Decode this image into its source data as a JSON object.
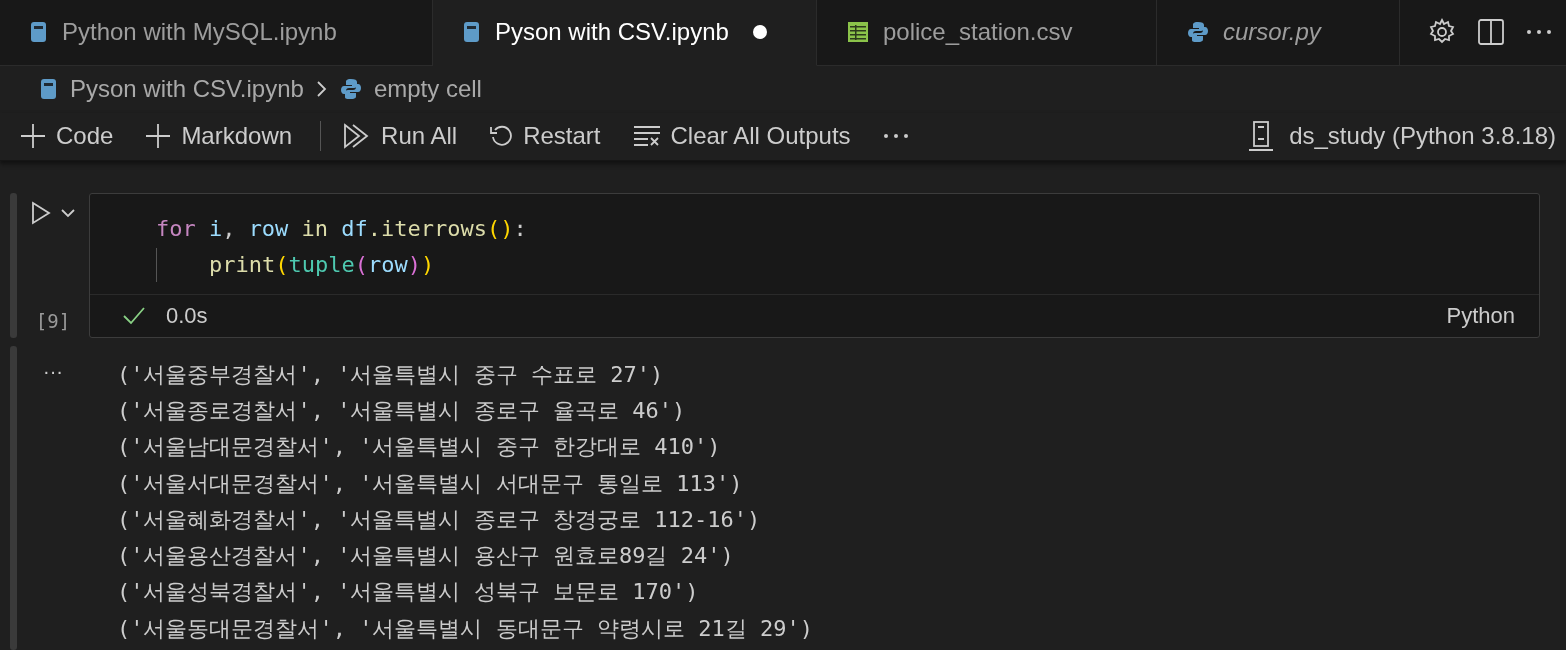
{
  "tabs": [
    {
      "label": "Python with MySQL.ipynb",
      "kind": "notebook",
      "selected": false,
      "modified": false,
      "italic": false
    },
    {
      "label": "Pyson with CSV.ipynb",
      "kind": "notebook",
      "selected": true,
      "modified": true,
      "italic": false
    },
    {
      "label": "police_station.csv",
      "kind": "csv",
      "selected": false,
      "modified": false,
      "italic": false
    },
    {
      "label": "cursor.py",
      "kind": "python",
      "selected": false,
      "modified": false,
      "italic": true
    }
  ],
  "breadcrumb": [
    {
      "label": "Pyson with CSV.ipynb",
      "kind": "notebook"
    },
    {
      "label": "empty cell",
      "kind": "python"
    }
  ],
  "toolbar": [
    {
      "label": "Code",
      "kind": "plus"
    },
    {
      "label": "Markdown",
      "kind": "plus"
    },
    {
      "kind": "separator"
    },
    {
      "label": "Run All",
      "kind": "run"
    },
    {
      "label": "Restart",
      "kind": "restart"
    },
    {
      "label": "Clear All Outputs",
      "kind": "clear"
    },
    {
      "kind": "more"
    }
  ],
  "kernel": "ds_study (Python 3.8.18)",
  "cell": {
    "execution_count": "[9]",
    "status": "0.0s",
    "success": true,
    "language": "Python",
    "lines": [
      {
        "indent": false,
        "tokens": [
          {
            "t": "for",
            "kind": "keyword",
            "gap": false
          },
          {
            "t": "i",
            "kind": "variable",
            "gap": true
          },
          {
            "t": ",",
            "kind": "plain",
            "gap": false
          },
          {
            "t": "row",
            "kind": "variable",
            "gap": true
          },
          {
            "t": "in",
            "kind": "function",
            "gap": true
          },
          {
            "t": "df",
            "kind": "variable",
            "gap": true
          },
          {
            "t": ".iterrows",
            "kind": "function",
            "gap": false
          },
          {
            "t": "()",
            "kind": "bracket1",
            "gap": false
          },
          {
            "t": ":",
            "kind": "plain",
            "gap": false
          }
        ]
      },
      {
        "indent": true,
        "tokens": [
          {
            "t": "print",
            "kind": "function",
            "gap": false
          },
          {
            "t": "(",
            "kind": "bracket1",
            "gap": false
          },
          {
            "t": "tuple",
            "kind": "builtin",
            "gap": false
          },
          {
            "t": "(",
            "kind": "bracket2",
            "gap": false
          },
          {
            "t": "row",
            "kind": "variable",
            "gap": false
          },
          {
            "t": ")",
            "kind": "bracket2",
            "gap": false
          },
          {
            "t": ")",
            "kind": "bracket1",
            "gap": false
          }
        ]
      }
    ]
  },
  "output": {
    "marker": "···",
    "lines": [
      "('서울중부경찰서', '서울특별시 중구 수표로 27')",
      "('서울종로경찰서', '서울특별시 종로구 율곡로 46')",
      "('서울남대문경찰서', '서울특별시 중구 한강대로 410')",
      "('서울서대문경찰서', '서울특별시 서대문구 통일로 113')",
      "('서울혜화경찰서', '서울특별시 종로구 창경궁로 112-16')",
      "('서울용산경찰서', '서울특별시 용산구 원효로89길 24')",
      "('서울성북경찰서', '서울특별시 성북구 보문로 170')",
      "('서울동대문경찰서', '서울특별시 동대문구 약령시로 21길 29')"
    ]
  }
}
